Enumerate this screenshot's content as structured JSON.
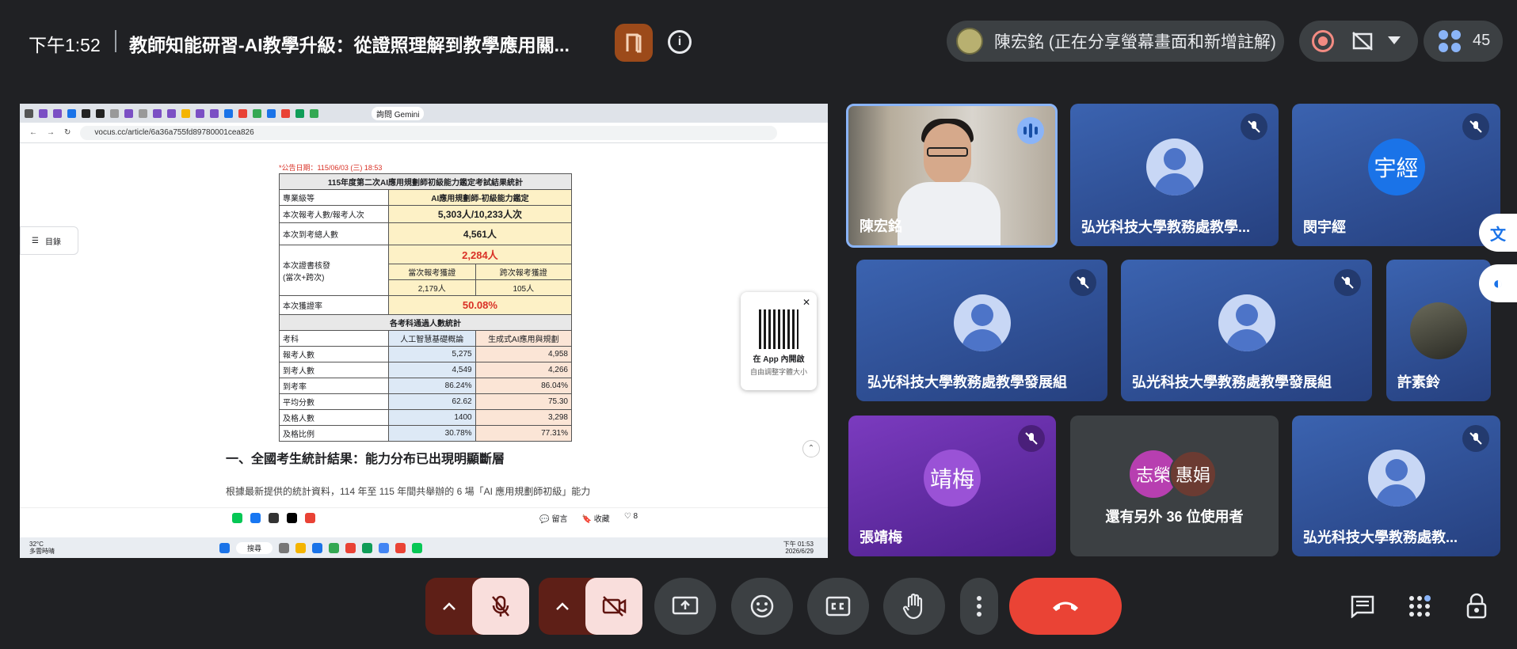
{
  "header": {
    "time": "下午1:52",
    "meeting_title": "教師知能研習-AI教學升級：從證照理解到教學應用關...",
    "presenter_status": "陳宏銘 (正在分享螢幕畫面和新增註解)",
    "participant_count": "45"
  },
  "screen": {
    "url": "vocus.cc/article/6a36a755fd89780001cea826",
    "gemini_label": "詢問 Gemini",
    "toc_label": "目錄",
    "publish_date": "*公告日期：115/06/03 (三) 18:53",
    "table": {
      "title": "115年度第二次AI應用規劃師初級能力鑑定考試結果統計",
      "rows": [
        {
          "label": "專業級等",
          "value": "AI應用規劃師-初級能力鑑定"
        },
        {
          "label": "本次報考人數/報考人次",
          "value": "5,303人/10,233人次"
        },
        {
          "label": "本次到考總人數",
          "value": "4,561人"
        },
        {
          "label": "本次證書核發\n(當次+跨次)",
          "value": "2,284人"
        },
        {
          "label": "本次獲證率",
          "value": "50.08%"
        }
      ],
      "sub_headers": [
        "當次報考獲證",
        "跨次報考獲證"
      ],
      "sub_values": [
        "2,179人",
        "105人"
      ],
      "section_title": "各考科通過人數統計",
      "columns": [
        "考科",
        "人工智慧基礎概論",
        "生成式AI應用與規劃"
      ],
      "data_rows": [
        [
          "報考人數",
          "5,275",
          "4,958"
        ],
        [
          "到考人數",
          "4,549",
          "4,266"
        ],
        [
          "到考率",
          "86.24%",
          "86.04%"
        ],
        [
          "平均分數",
          "62.62",
          "75.30"
        ],
        [
          "及格人數",
          "1400",
          "3,298"
        ],
        [
          "及格比例",
          "30.78%",
          "77.31%"
        ]
      ]
    },
    "qr": {
      "title": "在 App 內開啟",
      "subtitle": "自由調整字體大小"
    },
    "heading": "一、全國考生統計結果：能力分布已出現明顯斷層",
    "paragraph": "根據最新提供的統計資料，114 年至 115 年間共舉辦的 6 場「AI 應用規劃師初級」能力",
    "actions": {
      "comment": "留言",
      "collect": "收藏",
      "likes": "8"
    },
    "taskbar": {
      "weather": "32°C",
      "weather_sub": "多雲時晴",
      "search": "搜尋",
      "clock_time": "下午 01:53",
      "clock_date": "2026/6/29"
    }
  },
  "tiles": [
    {
      "name": "陳宏銘",
      "type": "camera"
    },
    {
      "name": "弘光科技大學教務處教學...",
      "type": "avatar"
    },
    {
      "name": "閔宇經",
      "type": "letter",
      "letter": "宇經",
      "color": "#1a73e8"
    },
    {
      "name": "弘光科技大學教務處教學發展組",
      "type": "avatar"
    },
    {
      "name": "弘光科技大學教務處教學發展組",
      "type": "avatar"
    },
    {
      "name": "許素鈴",
      "type": "photo"
    },
    {
      "name": "張靖梅",
      "type": "letter",
      "letter": "靖梅",
      "color": "#8e44c9"
    },
    {
      "name": "還有另外 36 位使用者",
      "type": "others",
      "a": "志榮",
      "b": "惠娟"
    },
    {
      "name": "弘光科技大學教務處教...",
      "type": "avatar"
    }
  ]
}
